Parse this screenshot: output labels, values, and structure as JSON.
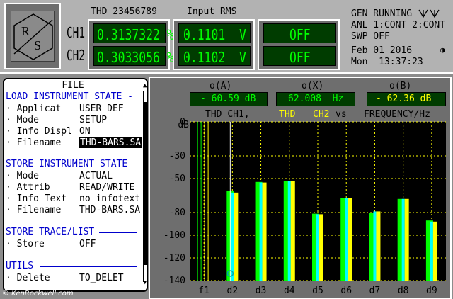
{
  "header": {
    "thd_label": "THD 23456789",
    "rms_label": "Input RMS",
    "ch1_label": "CH1",
    "ch2_label": "CH2",
    "ch1_thd": "0.3137322 %",
    "ch2_thd": "0.3033056 %",
    "ch1_rms": "0.1101  V",
    "ch2_rms": "0.1102  V",
    "ch1_off": "OFF",
    "ch2_off": "OFF"
  },
  "status": {
    "line1": "GEN RUNNING",
    "line2": "ANL 1:CONT 2:CONT",
    "line3": "SWP OFF",
    "date": "Feb 01 2016",
    "time": "Mon  13:37:23"
  },
  "file_panel": {
    "title": "FILE",
    "load_head": "LOAD INSTRUMENT STATE -",
    "load_rows": [
      {
        "key": "· Applicat",
        "value": "USER DEF"
      },
      {
        "key": "· Mode",
        "value": "SETUP"
      },
      {
        "key": "· Info Displ",
        "value": "ON"
      },
      {
        "key": "· Filename",
        "value": "THD-BARS.SA"
      }
    ],
    "store_head": "STORE INSTRUMENT STATE",
    "store_rows": [
      {
        "key": "· Mode",
        "value": "ACTUAL"
      },
      {
        "key": "· Attrib",
        "value": "READ/WRITE"
      },
      {
        "key": "· Info Text",
        "value": "no infotext"
      },
      {
        "key": "· Filename",
        "value": "THD-BARS.SA"
      }
    ],
    "trace_head": "STORE TRACE/LIST",
    "trace_rows": [
      {
        "key": "· Store",
        "value": "OFF"
      }
    ],
    "utils_head": "UTILS",
    "utils_rows": [
      {
        "key": "· Delete",
        "value": "TO_DELET"
      }
    ]
  },
  "graph": {
    "markers": [
      {
        "head": "o(A)",
        "value": "- 60.59 dB",
        "color": "#00ff00"
      },
      {
        "head": "o(X)",
        "value": "62.008  Hz",
        "color": "#00ff00"
      },
      {
        "head": "o(B)",
        "value": "- 62.36 dB",
        "color": "#ffff00"
      }
    ],
    "axis_unit": "dB",
    "hdr_thd": "THD",
    "hdr_ch1": "CH1,",
    "hdr_thd2": "THD",
    "hdr_ch2": "CH2",
    "hdr_vs": "vs",
    "hdr_freq": "FREQUENCY/Hz"
  },
  "chart_data": {
    "type": "bar",
    "categories": [
      "f1",
      "d2",
      "d3",
      "d4",
      "d5",
      "d6",
      "d7",
      "d8",
      "d9"
    ],
    "ylim": [
      -140,
      0
    ],
    "yticks": [
      0,
      -30,
      -50,
      -80,
      -100,
      -120,
      -140
    ],
    "series": [
      {
        "name": "CH1",
        "color": "#00ff00",
        "values": [
          0,
          -60.6,
          -53,
          -52.5,
          -81,
          -67,
          -80,
          -68,
          -87
        ]
      },
      {
        "name": "CH2",
        "color": "#ffff00",
        "values": [
          0,
          -62.4,
          -53.5,
          -52.5,
          -81.5,
          -67,
          -79,
          -68,
          -88
        ]
      }
    ],
    "grid": true
  },
  "colors": {
    "bar_ch1": "#00ff00",
    "bar_ch2": "#ffff00",
    "cyan_edge": "#00ffff",
    "grid": "#ffff00"
  },
  "watermark": "© KenRockwell.com"
}
